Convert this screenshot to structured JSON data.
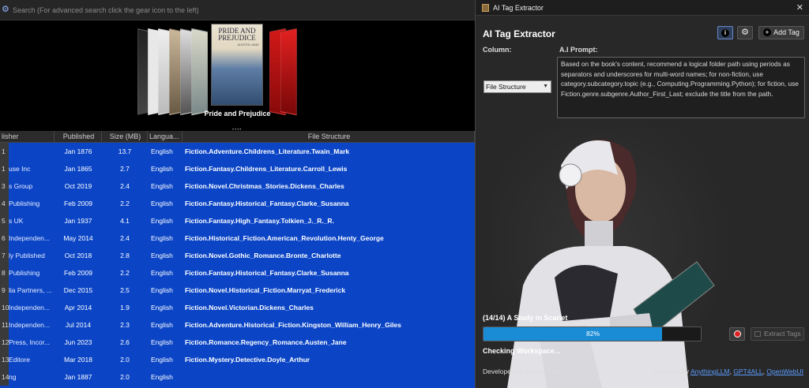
{
  "search": {
    "placeholder": "Search (For advanced search click the gear icon to the left)"
  },
  "carousel": {
    "caption": "Pride and Prejudice",
    "main_cover_title": "PRIDE AND PREJUDICE",
    "main_cover_author": "AUSTEN JANE"
  },
  "grid": {
    "headers": [
      "lisher",
      "Published",
      "Size (MB)",
      "Langua...",
      "File Structure"
    ],
    "rows": [
      {
        "idx": "1",
        "publisher": "",
        "published": "Jan 1876",
        "size": "13.7",
        "language": "English",
        "file_structure": "Fiction.Adventure.Childrens_Literature.Twain_Mark"
      },
      {
        "idx": "1",
        "publisher": "use Inc",
        "published": "Jan 1865",
        "size": "2.7",
        "language": "English",
        "file_structure": "Fiction.Fantasy.Childrens_Literature.Carroll_Lewis"
      },
      {
        "idx": "3",
        "publisher": "s Group",
        "published": "Oct 2019",
        "size": "2.4",
        "language": "English",
        "file_structure": "Fiction.Novel.Christmas_Stories.Dickens_Charles"
      },
      {
        "idx": "4",
        "publisher": "Publishing",
        "published": "Feb 2009",
        "size": "2.2",
        "language": "English",
        "file_structure": "Fiction.Fantasy.Historical_Fantasy.Clarke_Susanna"
      },
      {
        "idx": "5",
        "publisher": "s UK",
        "published": "Jan 1937",
        "size": "4.1",
        "language": "English",
        "file_structure": "Fiction.Fantasy.High_Fantasy.Tolkien_J._R._R."
      },
      {
        "idx": "6",
        "publisher": "Independen...",
        "published": "May 2014",
        "size": "2.4",
        "language": "English",
        "file_structure": "Fiction.Historical_Fiction.American_Revolution.Henty_George"
      },
      {
        "idx": "7",
        "publisher": "ly Published",
        "published": "Oct 2018",
        "size": "2.8",
        "language": "English",
        "file_structure": "Fiction.Novel.Gothic_Romance.Bronte_Charlotte"
      },
      {
        "idx": "8",
        "publisher": "Publishing",
        "published": "Feb 2009",
        "size": "2.2",
        "language": "English",
        "file_structure": "Fiction.Fantasy.Historical_Fantasy.Clarke_Susanna"
      },
      {
        "idx": "9",
        "publisher": "lia Partners, ...",
        "published": "Dec 2015",
        "size": "2.5",
        "language": "English",
        "file_structure": "Fiction.Novel.Historical_Fiction.Marryat_Frederick"
      },
      {
        "idx": "10",
        "publisher": "Independen...",
        "published": "Apr 2014",
        "size": "1.9",
        "language": "English",
        "file_structure": "Fiction.Novel.Victorian.Dickens_Charles"
      },
      {
        "idx": "11",
        "publisher": "Independen...",
        "published": "Jul 2014",
        "size": "2.3",
        "language": "English",
        "file_structure": "Fiction.Adventure.Historical_Fiction.Kingston_William_Henry_Giles"
      },
      {
        "idx": "12",
        "publisher": "Press, Incor...",
        "published": "Jun 2023",
        "size": "2.6",
        "language": "English",
        "file_structure": "Fiction.Romance.Regency_Romance.Austen_Jane"
      },
      {
        "idx": "13",
        "publisher": "Editore",
        "published": "Mar 2018",
        "size": "2.0",
        "language": "English",
        "file_structure": "Fiction.Mystery.Detective.Doyle_Arthur"
      },
      {
        "idx": "14",
        "publisher": "ng",
        "published": "Jan 1887",
        "size": "2.0",
        "language": "English",
        "file_structure": ""
      }
    ]
  },
  "dialog": {
    "window_title": "AI Tag Extractor",
    "close_glyph": "✕",
    "heading": "AI Tag Extractor",
    "add_tag_label": "Add Tag",
    "column_label": "Column:",
    "column_value": "File Structure",
    "prompt_label": "A.I Prompt:",
    "prompt_text": "Based on the book's content, recommend a logical folder path using periods as separators and underscores for multi-word names; for non-fiction, use category.subcategory.topic (e.g., Computing.Programming.Python); for fiction, use Fiction.genre.subgenre.Author_First_Last; exclude the title from the path.",
    "current_book": "(14/14) A Study in Scarlet",
    "progress": 82,
    "progress_label": "82%",
    "status": "Checking Workspace...",
    "extract_label": "Extract Tags",
    "developed_by": "Developed by Digital Assassins",
    "powered_by": "Powered By",
    "links": [
      "AnythingLLM",
      "GPT4ALL",
      "OpenWebUI"
    ]
  },
  "colors": {
    "grid_selection": "#0b45c6",
    "progress": "#1a8cd6",
    "accent_link": "#5b9cff"
  },
  "icons": [
    "gear-icon",
    "info-icon",
    "settings-icon",
    "plus-icon",
    "close-icon",
    "record-icon"
  ]
}
